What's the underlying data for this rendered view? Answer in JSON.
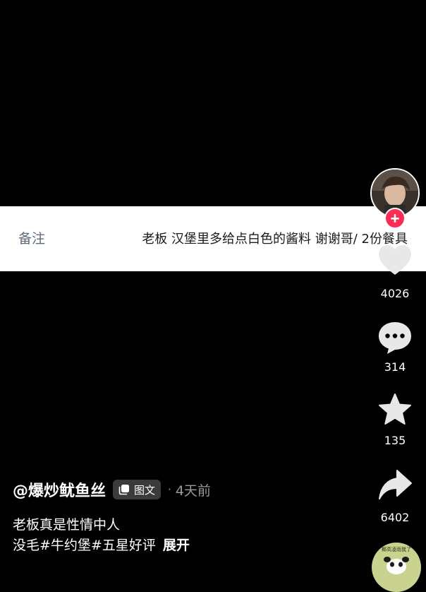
{
  "note_banner": {
    "label": "备注",
    "text": "老板 汉堡里多给点白色的酱料 谢谢哥/ 2份餐具"
  },
  "rail": {
    "avatar_icon": "user-avatar-photo",
    "follow_icon": "plus-icon",
    "like": {
      "icon": "heart-icon",
      "count": "4026"
    },
    "comment": {
      "icon": "comment-bubble-icon",
      "count": "314"
    },
    "favorite": {
      "icon": "star-icon",
      "count": "135"
    },
    "share": {
      "icon": "share-arrow-icon",
      "count": "6402"
    },
    "music_disc": {
      "text": "椰高凌雨我了"
    }
  },
  "post": {
    "author": "@爆炒鱿鱼丝",
    "type_tag": "图文",
    "separator": "·",
    "time_ago": "4天前",
    "caption_line1": "老板真是性情中人",
    "caption_line2": "没毛#牛约堡#五星好评",
    "expand_label": "展开"
  },
  "colors": {
    "background": "#000000",
    "banner": "#ffffff",
    "follow_accent": "#fe2c55",
    "secondary_text": "#9a9a9a"
  }
}
